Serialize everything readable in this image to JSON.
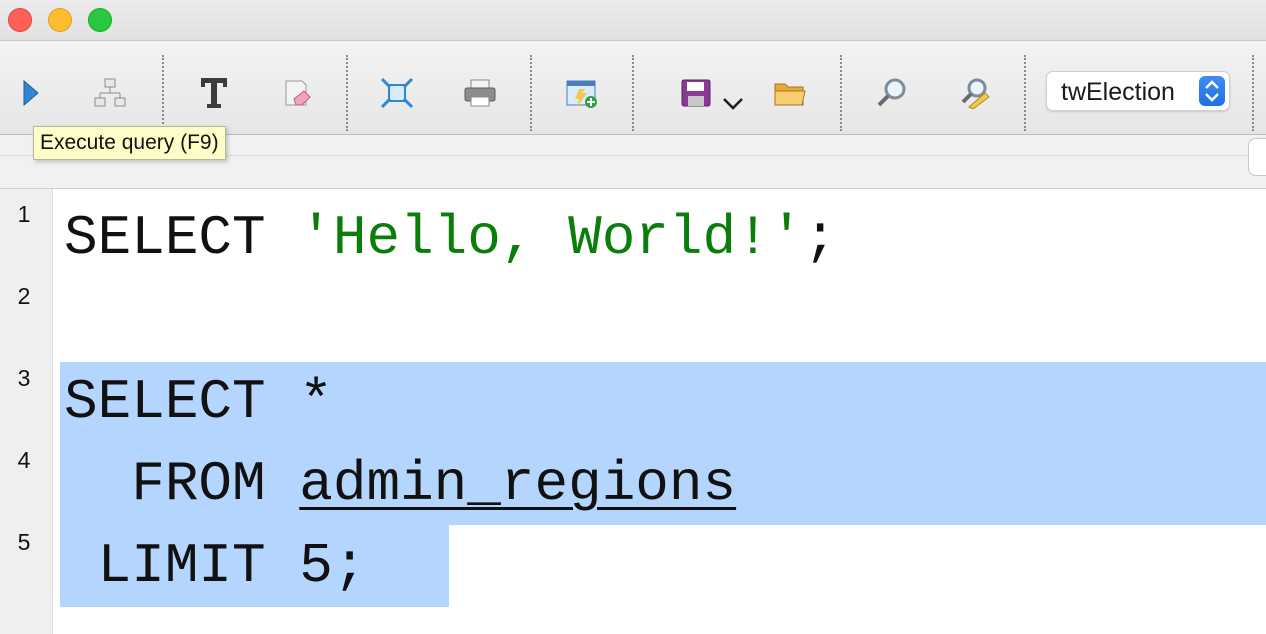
{
  "window": {
    "controls": [
      "close",
      "minimize",
      "maximize"
    ]
  },
  "toolbar": {
    "buttons": [
      {
        "name": "execute-query",
        "icon": "play-triangle-icon"
      },
      {
        "name": "explain",
        "icon": "hierarchy-icon"
      },
      {
        "name": "text-mode",
        "icon": "text-t-icon"
      },
      {
        "name": "clear",
        "icon": "eraser-icon"
      },
      {
        "name": "expand",
        "icon": "expand-arrows-icon"
      },
      {
        "name": "print",
        "icon": "printer-icon"
      },
      {
        "name": "new-tab",
        "icon": "new-window-icon"
      },
      {
        "name": "save",
        "icon": "floppy-disk-icon"
      },
      {
        "name": "open",
        "icon": "folder-icon"
      },
      {
        "name": "find",
        "icon": "magnifier-icon"
      },
      {
        "name": "find-replace",
        "icon": "magnifier-pencil-icon"
      }
    ],
    "database_select": {
      "value": "twElection"
    }
  },
  "tooltip": {
    "text": "Execute query (F9)"
  },
  "editor": {
    "line_numbers": [
      "1",
      "2",
      "3",
      "4",
      "5"
    ],
    "lines": [
      {
        "kw": "SELECT ",
        "str": "'Hello, World!'",
        "end": ";"
      },
      {
        "text": ""
      },
      {
        "text": "SELECT *"
      },
      {
        "kw": "  FROM ",
        "table": "admin_regions"
      },
      {
        "text": " LIMIT 5;"
      }
    ],
    "selected_lines": [
      "3",
      "4",
      "5"
    ],
    "colors": {
      "string": "#0a7d0a",
      "selection": "#b4d5fe"
    }
  }
}
